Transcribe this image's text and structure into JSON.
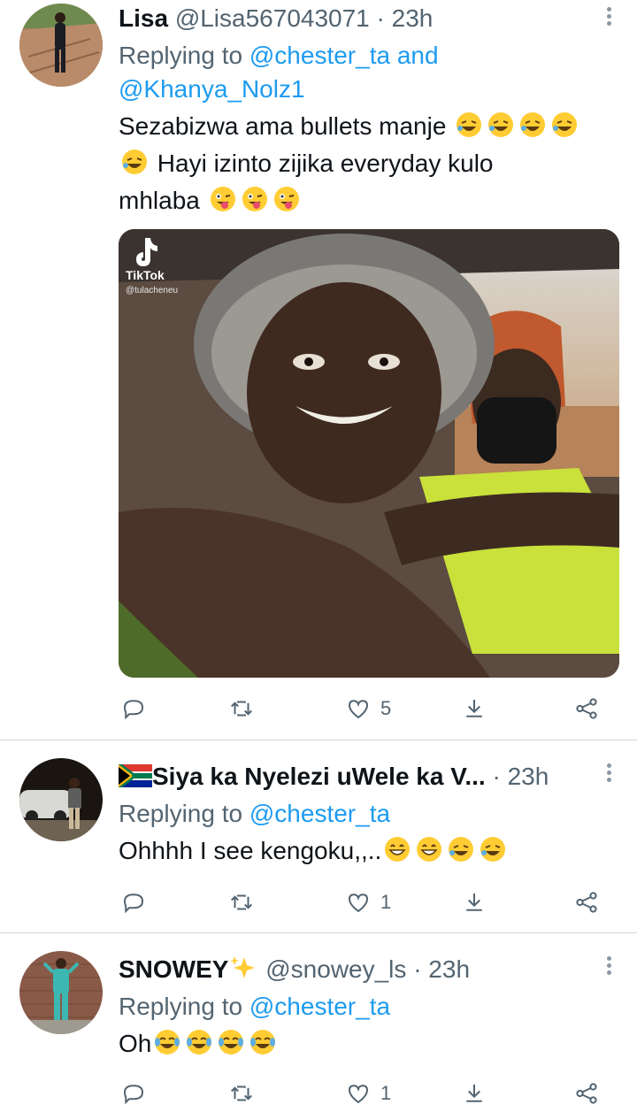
{
  "tweets": [
    {
      "name": "Lisa",
      "handle": "@Lisa567043071",
      "time": "23h",
      "reply_prefix": "Replying to",
      "reply_mention_1": "@chester_ta",
      "reply_and": "and",
      "reply_mention_2": "@Khanya_Nolz1",
      "text_1": "Sezabizwa ama bullets manje",
      "text_2": "Hayi izinto zijika everyday kulo",
      "text_3": "mhlaba",
      "media": {
        "watermark_brand": "TikTok",
        "watermark_user": "@tulacheneu"
      },
      "likes": "5"
    },
    {
      "name": "Siya ka Nyelezi uWele ka V...",
      "flag": "south-africa-flag-emoji",
      "time": "23h",
      "reply_prefix": "Replying to",
      "reply_mention_1": "@chester_ta",
      "text_1": "Ohhhh I see kengoku,,..",
      "likes": "1"
    },
    {
      "name": "SNOWEY",
      "name_emoji": "sparkles-emoji",
      "handle": "@snowey_ls",
      "time": "23h",
      "reply_prefix": "Replying to",
      "reply_mention_1": "@chester_ta",
      "text_1": "Oh",
      "likes": "1"
    }
  ],
  "dot": "·",
  "colors": {
    "accent": "#1d9bf0",
    "secondary_text": "#536471",
    "primary_text": "#0f1419",
    "divider": "#cfd9de",
    "emoji_yellow": "#ffcc33"
  },
  "icons": [
    "reply-icon",
    "retweet-icon",
    "like-icon",
    "download-icon",
    "share-icon",
    "more-options-icon"
  ]
}
